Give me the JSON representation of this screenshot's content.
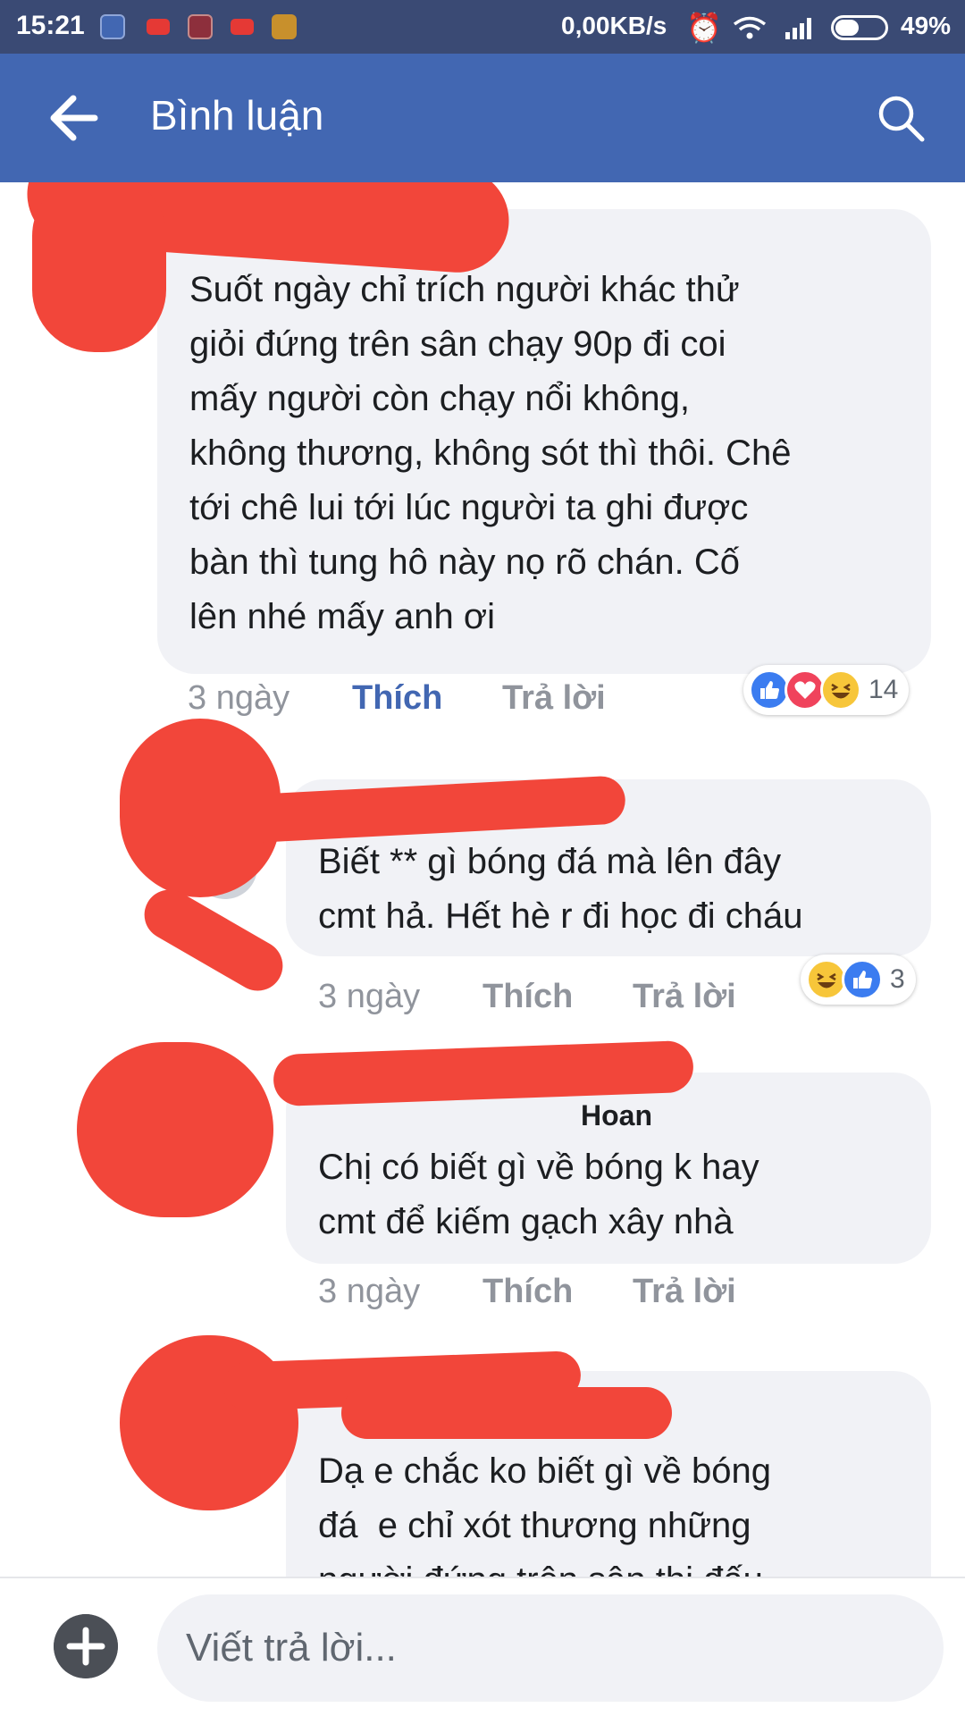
{
  "status_bar": {
    "time": "15:21",
    "net_speed": "0,00KB/s",
    "battery": "49%",
    "battery_level": 0.49,
    "notification_icons": [
      "facebook-icon",
      "youtube-icon",
      "mi-icon",
      "youtube-icon",
      "uc-icon"
    ]
  },
  "app_bar": {
    "title": "Bình luận",
    "back_icon": "arrow-left-icon",
    "search_icon": "search-icon",
    "color": "#4267b2"
  },
  "comments": [
    {
      "author": "",
      "text": "Suốt ngày chỉ trích người khác thử\ngiỏi đứng trên sân chạy 90p đi coi\nmấy người còn chạy nổi không,\nkhông thương, không sót thì thôi. Chê\ntới chê lui tới lúc người ta ghi được\nbàn thì tung hô này nọ rõ chán. Cố\nlên nhé mấy anh ơi",
      "time": "3 ngày",
      "like_label": "Thích",
      "reply_label": "Trả lời",
      "liked": true,
      "reactions": [
        "like",
        "love",
        "haha"
      ],
      "reaction_count": "14"
    },
    {
      "author": "",
      "text": "Biết ** gì bóng đá mà lên đây\ncmt hả. Hết hè r đi học đi cháu",
      "time": "3 ngày",
      "like_label": "Thích",
      "reply_label": "Trả lời",
      "liked": false,
      "reactions": [
        "haha",
        "like"
      ],
      "reaction_count": "3"
    },
    {
      "author": "Hoan",
      "text": "Chị có biết gì về bóng k hay\ncmt để kiếm gạch xây nhà",
      "time": "3 ngày",
      "like_label": "Thích",
      "reply_label": "Trả lời",
      "liked": false,
      "reactions": [],
      "reaction_count": ""
    },
    {
      "author": "",
      "text": "Dạ e chắc ko biết gì về bóng\nđá  e chỉ xót thương những\nngười đứng trên sân thi đấu",
      "time": "",
      "like_label": "",
      "reply_label": "",
      "liked": false,
      "reactions": [],
      "reaction_count": ""
    }
  ],
  "reply_bar": {
    "placeholder": "Viết trả lời...",
    "add_icon": "plus-icon"
  }
}
